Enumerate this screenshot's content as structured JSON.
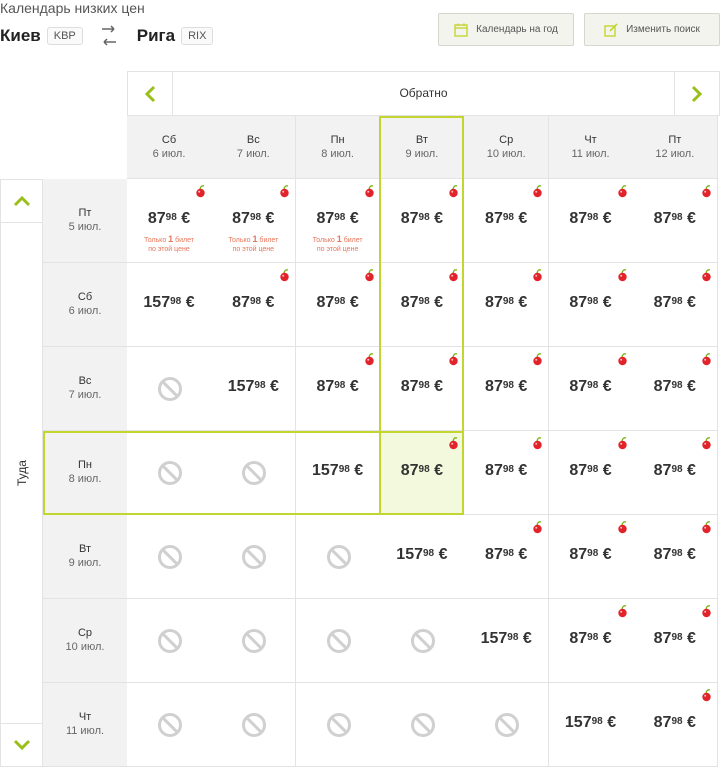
{
  "header": {
    "title": "Календарь низких цен",
    "from_city": "Киев",
    "from_code": "KBP",
    "to_city": "Рига",
    "to_code": "RIX",
    "calendar_year_label": "Календарь на год",
    "change_search_label": "Изменить поиск"
  },
  "colors": {
    "accent": "#c3d62f",
    "nav_arrow": "#9bbf1a",
    "highlight": "#f2f9dc",
    "note": "#e8765a"
  },
  "nav": {
    "return_label": "Обратно",
    "outbound_label": "Туда"
  },
  "columns": [
    {
      "day": "Сб",
      "date": "6 июл."
    },
    {
      "day": "Вс",
      "date": "7 июл."
    },
    {
      "day": "Пн",
      "date": "8 июл."
    },
    {
      "day": "Вт",
      "date": "9 июл."
    },
    {
      "day": "Ср",
      "date": "10 июл."
    },
    {
      "day": "Чт",
      "date": "11 июл."
    },
    {
      "day": "Пт",
      "date": "12 июл."
    }
  ],
  "rows": [
    {
      "day": "Пт",
      "date": "5 июл."
    },
    {
      "day": "Сб",
      "date": "6 июл."
    },
    {
      "day": "Вс",
      "date": "7 июл."
    },
    {
      "day": "Пн",
      "date": "8 июл."
    },
    {
      "day": "Вт",
      "date": "9 июл."
    },
    {
      "day": "Ср",
      "date": "10 июл."
    },
    {
      "day": "Чт",
      "date": "11 июл."
    }
  ],
  "note": {
    "pre": "Только ",
    "num": "1",
    "post": " билет",
    "line2": "по этой цене"
  },
  "selected": {
    "row": 3,
    "col": 3
  },
  "grid": [
    [
      {
        "euro": "87",
        "cents": "98",
        "cur": "€",
        "offer": true,
        "note": true
      },
      {
        "euro": "87",
        "cents": "98",
        "cur": "€",
        "offer": true,
        "note": true
      },
      {
        "euro": "87",
        "cents": "98",
        "cur": "€",
        "offer": true,
        "note": true
      },
      {
        "euro": "87",
        "cents": "98",
        "cur": "€",
        "offer": true
      },
      {
        "euro": "87",
        "cents": "98",
        "cur": "€",
        "offer": true
      },
      {
        "euro": "87",
        "cents": "98",
        "cur": "€",
        "offer": true
      },
      {
        "euro": "87",
        "cents": "98",
        "cur": "€",
        "offer": true
      }
    ],
    [
      {
        "euro": "157",
        "cents": "98",
        "cur": "€"
      },
      {
        "euro": "87",
        "cents": "98",
        "cur": "€",
        "offer": true
      },
      {
        "euro": "87",
        "cents": "98",
        "cur": "€",
        "offer": true
      },
      {
        "euro": "87",
        "cents": "98",
        "cur": "€",
        "offer": true
      },
      {
        "euro": "87",
        "cents": "98",
        "cur": "€",
        "offer": true
      },
      {
        "euro": "87",
        "cents": "98",
        "cur": "€",
        "offer": true
      },
      {
        "euro": "87",
        "cents": "98",
        "cur": "€",
        "offer": true
      }
    ],
    [
      null,
      {
        "euro": "157",
        "cents": "98",
        "cur": "€"
      },
      {
        "euro": "87",
        "cents": "98",
        "cur": "€",
        "offer": true
      },
      {
        "euro": "87",
        "cents": "98",
        "cur": "€",
        "offer": true
      },
      {
        "euro": "87",
        "cents": "98",
        "cur": "€",
        "offer": true
      },
      {
        "euro": "87",
        "cents": "98",
        "cur": "€",
        "offer": true
      },
      {
        "euro": "87",
        "cents": "98",
        "cur": "€",
        "offer": true
      }
    ],
    [
      null,
      null,
      {
        "euro": "157",
        "cents": "98",
        "cur": "€"
      },
      {
        "euro": "87",
        "cents": "98",
        "cur": "€",
        "offer": true
      },
      {
        "euro": "87",
        "cents": "98",
        "cur": "€",
        "offer": true
      },
      {
        "euro": "87",
        "cents": "98",
        "cur": "€",
        "offer": true
      },
      {
        "euro": "87",
        "cents": "98",
        "cur": "€",
        "offer": true
      }
    ],
    [
      null,
      null,
      null,
      {
        "euro": "157",
        "cents": "98",
        "cur": "€"
      },
      {
        "euro": "87",
        "cents": "98",
        "cur": "€",
        "offer": true
      },
      {
        "euro": "87",
        "cents": "98",
        "cur": "€",
        "offer": true
      },
      {
        "euro": "87",
        "cents": "98",
        "cur": "€",
        "offer": true
      }
    ],
    [
      null,
      null,
      null,
      null,
      {
        "euro": "157",
        "cents": "98",
        "cur": "€"
      },
      {
        "euro": "87",
        "cents": "98",
        "cur": "€",
        "offer": true
      },
      {
        "euro": "87",
        "cents": "98",
        "cur": "€",
        "offer": true
      }
    ],
    [
      null,
      null,
      null,
      null,
      null,
      {
        "euro": "157",
        "cents": "98",
        "cur": "€"
      },
      {
        "euro": "87",
        "cents": "98",
        "cur": "€",
        "offer": true
      }
    ]
  ]
}
